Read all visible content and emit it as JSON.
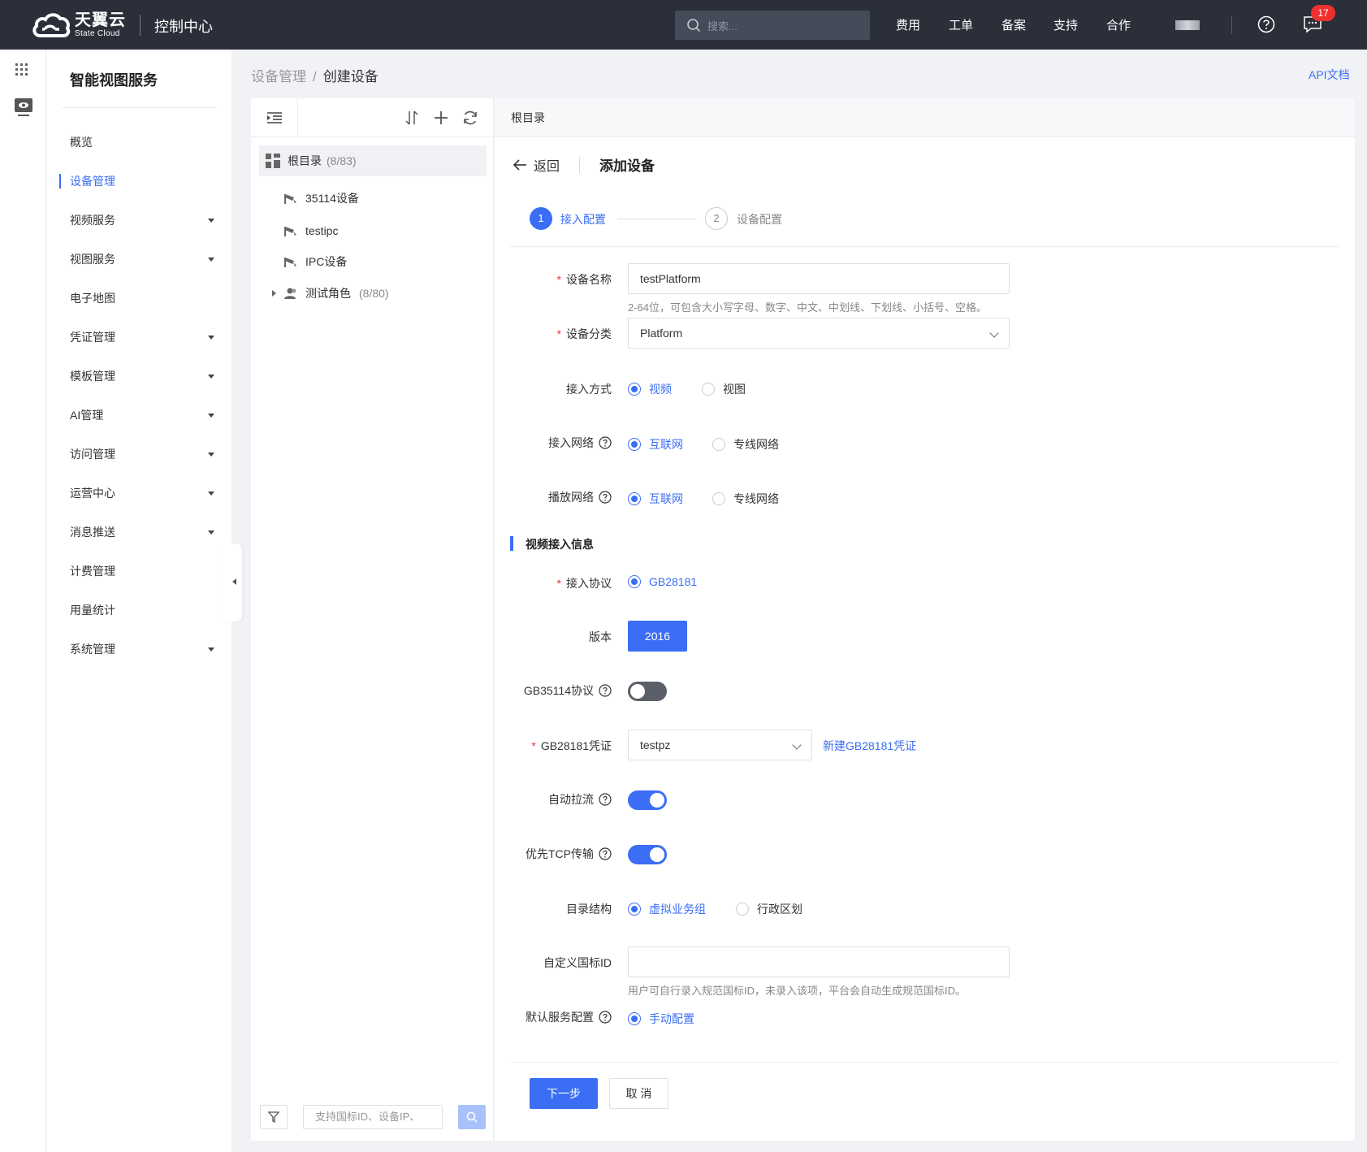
{
  "topbar": {
    "brand_cn": "天翼云",
    "brand_en": "State Cloud",
    "console_title": "控制中心",
    "search_placeholder": "搜索...",
    "nav": [
      "费用",
      "工单",
      "备案",
      "支持",
      "合作"
    ],
    "notification_count": "17"
  },
  "sidebar": {
    "title": "智能视图服务",
    "items": [
      {
        "label": "概览",
        "dropdown": false,
        "active": false
      },
      {
        "label": "设备管理",
        "dropdown": false,
        "active": true
      },
      {
        "label": "视频服务",
        "dropdown": true,
        "active": false
      },
      {
        "label": "视图服务",
        "dropdown": true,
        "active": false
      },
      {
        "label": "电子地图",
        "dropdown": false,
        "active": false
      },
      {
        "label": "凭证管理",
        "dropdown": true,
        "active": false
      },
      {
        "label": "模板管理",
        "dropdown": true,
        "active": false
      },
      {
        "label": "AI管理",
        "dropdown": true,
        "active": false
      },
      {
        "label": "访问管理",
        "dropdown": true,
        "active": false
      },
      {
        "label": "运营中心",
        "dropdown": true,
        "active": false
      },
      {
        "label": "消息推送",
        "dropdown": true,
        "active": false
      },
      {
        "label": "计费管理",
        "dropdown": false,
        "active": false
      },
      {
        "label": "用量统计",
        "dropdown": false,
        "active": false
      },
      {
        "label": "系统管理",
        "dropdown": true,
        "active": false
      }
    ]
  },
  "breadcrumb": {
    "parent": "设备管理",
    "separator": "/",
    "current": "创建设备"
  },
  "api_doc_link": "API文档",
  "tree": {
    "root_label": "根目录",
    "root_count": "(8/83)",
    "nodes": [
      {
        "label": "35114设备",
        "count": ""
      },
      {
        "label": "testipc",
        "count": ""
      },
      {
        "label": "IPC设备",
        "count": ""
      },
      {
        "label": "测试角色",
        "count": "(8/80)"
      }
    ],
    "search_placeholder": "支持国标ID、设备IP、"
  },
  "main": {
    "header": "根目录",
    "back_label": "返回",
    "page_title": "添加设备",
    "steps": [
      {
        "number": "1",
        "label": "接入配置",
        "active": true
      },
      {
        "number": "2",
        "label": "设备配置",
        "active": false
      }
    ],
    "form": {
      "device_name": {
        "label": "设备名称",
        "value": "testPlatform",
        "hint": "2-64位，可包含大小写字母、数字、中文、中划线、下划线、小括号、空格。"
      },
      "device_category": {
        "label": "设备分类",
        "value": "Platform"
      },
      "access_mode": {
        "label": "接入方式",
        "options": [
          "视频",
          "视图"
        ],
        "selected": "视频"
      },
      "access_network": {
        "label": "接入网络",
        "options": [
          "互联网",
          "专线网络"
        ],
        "selected": "互联网"
      },
      "play_network": {
        "label": "播放网络",
        "options": [
          "互联网",
          "专线网络"
        ],
        "selected": "互联网"
      },
      "section_title": "视频接入信息",
      "protocol": {
        "label": "接入协议",
        "options": [
          "GB28181"
        ],
        "selected": "GB28181"
      },
      "version": {
        "label": "版本",
        "value": "2016"
      },
      "gb35114": {
        "label": "GB35114协议",
        "enabled": false
      },
      "gb28181_credential": {
        "label": "GB28181凭证",
        "value": "testpz",
        "link": "新建GB28181凭证"
      },
      "auto_pull": {
        "label": "自动拉流",
        "enabled": true
      },
      "prefer_tcp": {
        "label": "优先TCP传输",
        "enabled": true
      },
      "directory_structure": {
        "label": "目录结构",
        "options": [
          "虚拟业务组",
          "行政区划"
        ],
        "selected": "虚拟业务组"
      },
      "custom_id": {
        "label": "自定义国标ID",
        "value": "",
        "hint": "用户可自行录入规范国标ID，未录入该项，平台会自动生成规范国标ID。"
      },
      "default_service": {
        "label": "默认服务配置",
        "options": [
          "手动配置"
        ],
        "selected": "手动配置"
      }
    },
    "buttons": {
      "next": "下一步",
      "cancel": "取 消"
    }
  },
  "colors": {
    "accent": "#3b6ef5",
    "topbar": "#2b2f3a",
    "required": "#f0302e"
  }
}
